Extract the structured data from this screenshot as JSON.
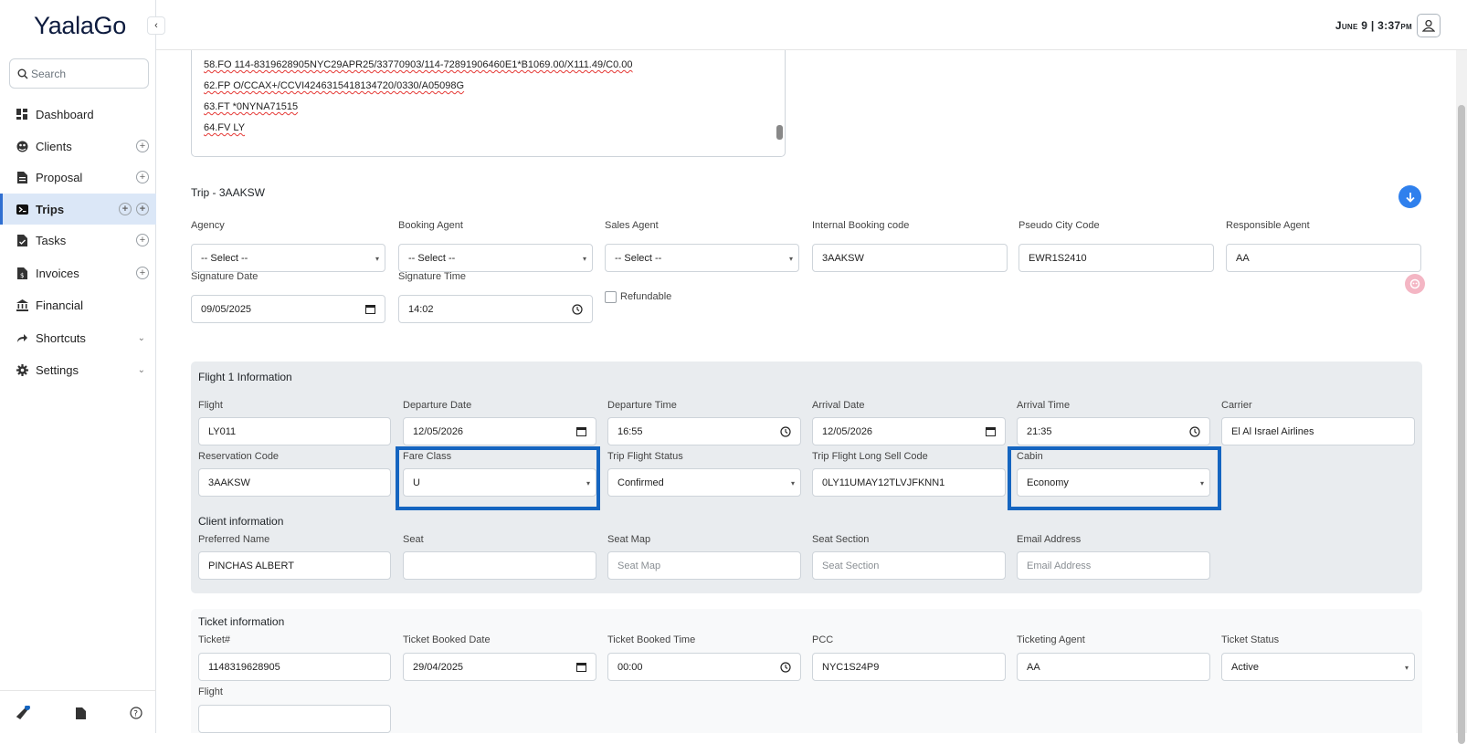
{
  "app": {
    "logo": "YaalaGo",
    "datetime": "June 9 | 3:37pm"
  },
  "search": {
    "placeholder": "Search"
  },
  "sidebar": {
    "items": [
      {
        "label": "Dashboard",
        "icon": "dashboard-icon"
      },
      {
        "label": "Clients",
        "icon": "clients-icon"
      },
      {
        "label": "Proposal",
        "icon": "proposal-icon"
      },
      {
        "label": "Trips",
        "icon": "trips-icon"
      },
      {
        "label": "Tasks",
        "icon": "tasks-icon"
      },
      {
        "label": "Invoices",
        "icon": "invoices-icon"
      },
      {
        "label": "Financial",
        "icon": "bank-icon"
      },
      {
        "label": "Shortcuts",
        "icon": "share-icon"
      },
      {
        "label": "Settings",
        "icon": "gear-icon"
      }
    ]
  },
  "pnr": {
    "lines": [
      "58.FO 114-8319628905NYC29APR25/33770903/114-72891906460E1*B1069.00/X111.49/C0.00",
      "62.FP O/CCAX+/CCVI4246315418134720/0330/A05098G",
      "63.FT *0NYNA71515",
      "64.FV LY"
    ]
  },
  "trip": {
    "title": "Trip - 3AAKSW",
    "agency": {
      "label": "Agency",
      "value": "-- Select --"
    },
    "booking_agent": {
      "label": "Booking Agent",
      "value": "-- Select --"
    },
    "sales_agent": {
      "label": "Sales Agent",
      "value": "-- Select --"
    },
    "internal_code": {
      "label": "Internal Booking code",
      "value": "3AAKSW"
    },
    "pcc": {
      "label": "Pseudo City Code",
      "value": "EWR1S2410"
    },
    "responsible": {
      "label": "Responsible Agent",
      "value": "AA"
    },
    "sig_date": {
      "label": "Signature Date",
      "value": "09/05/2025"
    },
    "sig_time": {
      "label": "Signature Time",
      "value": "14:02"
    },
    "refundable": {
      "label": "Refundable",
      "checked": false
    }
  },
  "flight": {
    "title": "Flight 1 Information",
    "flight": {
      "label": "Flight",
      "value": "LY011"
    },
    "dep_date": {
      "label": "Departure Date",
      "value": "12/05/2026"
    },
    "dep_time": {
      "label": "Departure Time",
      "value": "16:55"
    },
    "arr_date": {
      "label": "Arrival Date",
      "value": "12/05/2026"
    },
    "arr_time": {
      "label": "Arrival Time",
      "value": "21:35"
    },
    "carrier": {
      "label": "Carrier",
      "value": "El Al Israel Airlines"
    },
    "res_code": {
      "label": "Reservation Code",
      "value": "3AAKSW"
    },
    "fare_class": {
      "label": "Fare Class",
      "value": "U"
    },
    "status": {
      "label": "Trip Flight Status",
      "value": "Confirmed"
    },
    "sell_code": {
      "label": "Trip Flight Long Sell Code",
      "value": "0LY11UMAY12TLVJFKNN1"
    },
    "cabin": {
      "label": "Cabin",
      "value": "Economy"
    }
  },
  "client": {
    "title": "Client information",
    "preferred": {
      "label": "Preferred Name",
      "value": "PINCHAS ALBERT"
    },
    "seat": {
      "label": "Seat",
      "value": ""
    },
    "seat_map": {
      "label": "Seat Map",
      "placeholder": "Seat Map"
    },
    "seat_section": {
      "label": "Seat Section",
      "placeholder": "Seat Section"
    },
    "email": {
      "label": "Email Address",
      "placeholder": "Email Address"
    }
  },
  "ticket": {
    "title": "Ticket information",
    "ticket_no": {
      "label": "Ticket#",
      "value": "1148319628905"
    },
    "booked_date": {
      "label": "Ticket Booked Date",
      "value": "29/04/2025"
    },
    "booked_time": {
      "label": "Ticket Booked Time",
      "value": "00:00"
    },
    "pcc": {
      "label": "PCC",
      "value": "NYC1S24P9"
    },
    "agent": {
      "label": "Ticketing Agent",
      "value": "AA"
    },
    "status": {
      "label": "Ticket Status",
      "value": "Active"
    },
    "flight": {
      "label": "Flight",
      "value": ""
    }
  },
  "colors": {
    "accent": "#2f80ed",
    "highlight": "#1565c0",
    "active_nav": "#dbe7f7"
  }
}
